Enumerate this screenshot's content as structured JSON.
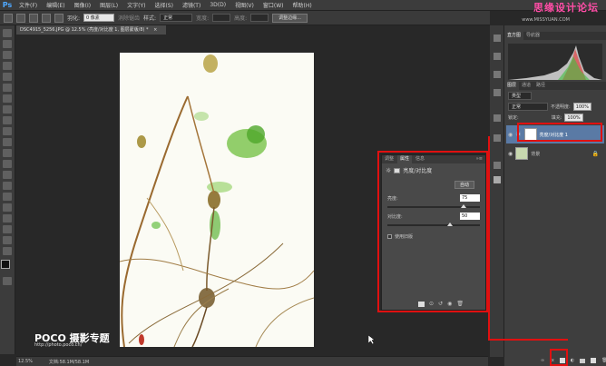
{
  "menubar": {
    "logo": "Ps",
    "items": [
      "文件(F)",
      "编辑(E)",
      "图像(I)",
      "图层(L)",
      "文字(Y)",
      "选择(S)",
      "滤镜(T)",
      "3D(D)",
      "视图(V)",
      "窗口(W)",
      "帮助(H)"
    ]
  },
  "watermark": {
    "text": "思缘设计论坛",
    "url": "www.MISSYUAN.COM"
  },
  "options": {
    "feather_label": "羽化:",
    "feather_value": "0 像素",
    "antialias_label": "消除锯齿",
    "style_label": "样式:",
    "style_value": "正常",
    "width_label": "宽度:",
    "height_label": "高度:",
    "refine_button": "调整边缘..."
  },
  "document": {
    "tab": "DSC4915_5256.JPG @ 12.5% (亮度/对比度 1, 图层蒙版/8) *",
    "close_glyph": "×"
  },
  "status": {
    "zoom": "12.5%",
    "doc_info": "文档:58.1M/58.1M"
  },
  "poco": {
    "brand": "POCO 摄影专题",
    "url": "http://photo.poco.cn/"
  },
  "properties": {
    "tabs": [
      "调整",
      "属性",
      "信息"
    ],
    "title": "亮度/对比度",
    "auto_button": "自动",
    "brightness_label": "亮度:",
    "brightness_value": "75",
    "contrast_label": "对比度:",
    "contrast_value": "50",
    "legacy_label": "使用旧版",
    "brightness_fraction": 0.82,
    "contrast_fraction": 0.68
  },
  "histogram": {
    "tabs": [
      "直方图",
      "导航器"
    ]
  },
  "layers": {
    "tabs": [
      "图层",
      "通道",
      "路径"
    ],
    "filter_value": "类型",
    "blend_value": "正常",
    "opacity_label": "不透明度:",
    "opacity_value": "100%",
    "lock_label": "锁定:",
    "fill_label": "填充:",
    "fill_value": "100%",
    "rows": [
      {
        "name": "亮度/对比度 1"
      },
      {
        "name": "背景"
      }
    ]
  },
  "colors": {
    "highlight": "#e01010",
    "selected_row": "#5a7aa5"
  }
}
